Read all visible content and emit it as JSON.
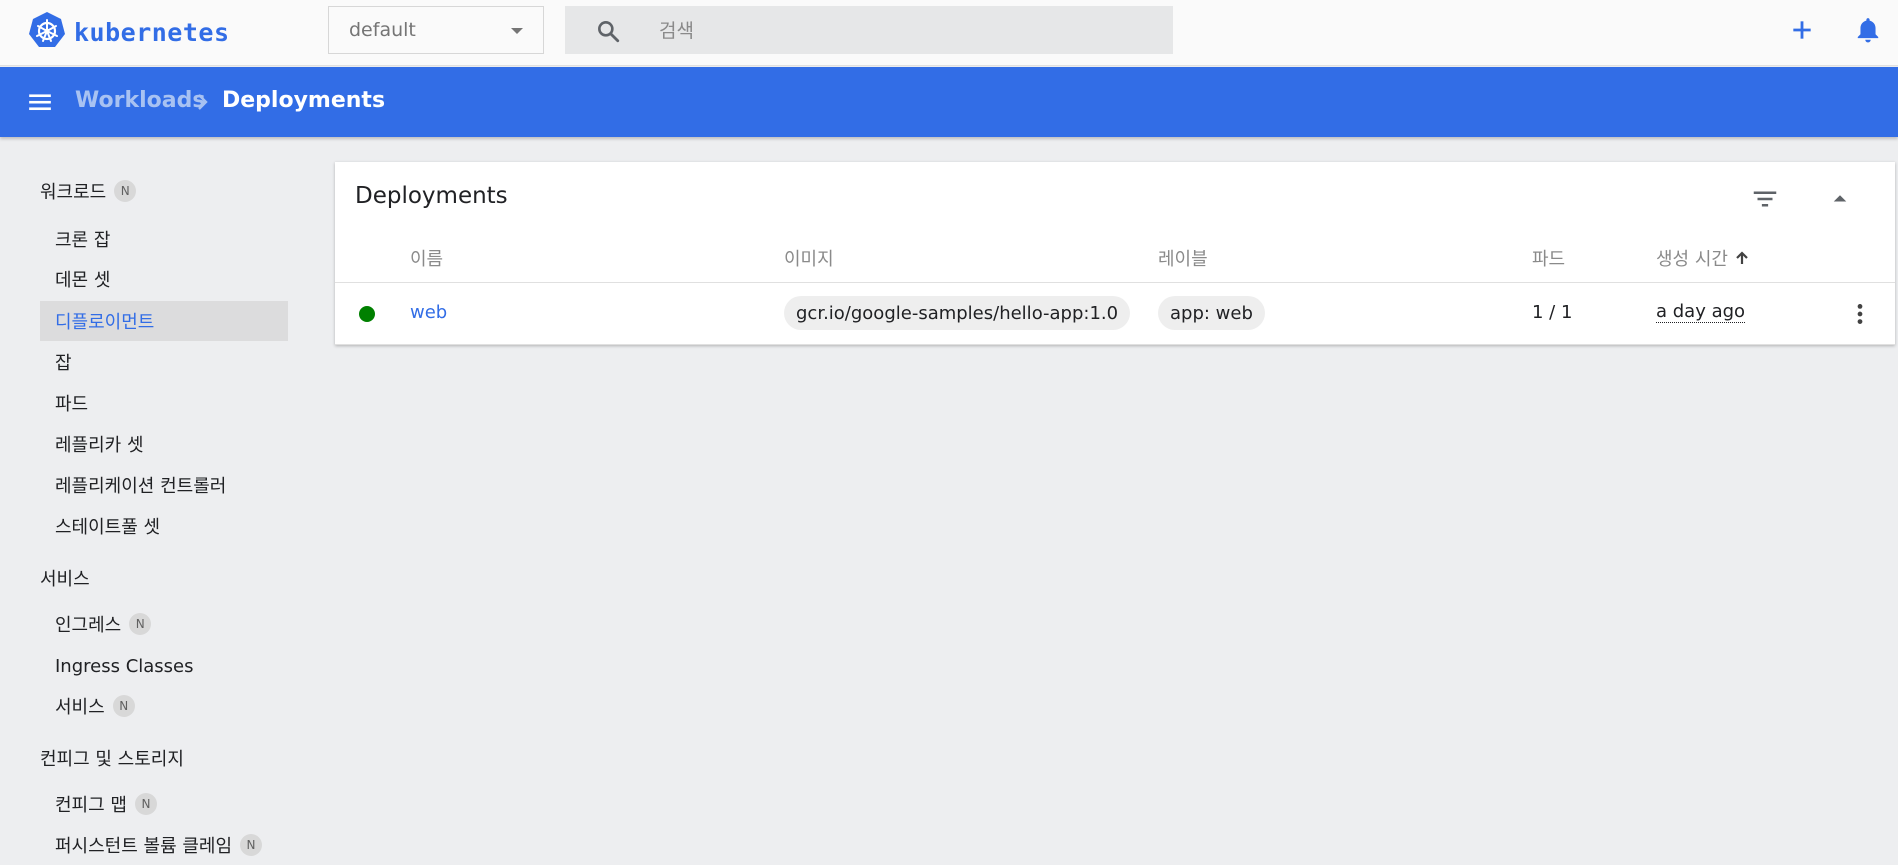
{
  "app": {
    "logo_text": "kubernetes"
  },
  "colors": {
    "brand": "#326de6",
    "status_ok": "#008000"
  },
  "namespace_select": {
    "value": "default"
  },
  "search": {
    "placeholder": "검색",
    "icon": "search-icon"
  },
  "top_actions": {
    "create_icon": "plus-icon",
    "notifications_icon": "bell-icon"
  },
  "breadcrumb": {
    "parent": "Workloads",
    "current": "Deployments"
  },
  "sidebar": {
    "sections": [
      {
        "title": "워크로드",
        "badge": "N",
        "items": [
          {
            "label": "크론 잡"
          },
          {
            "label": "데몬 셋"
          },
          {
            "label": "디플로이먼트",
            "active": true
          },
          {
            "label": "잡"
          },
          {
            "label": "파드"
          },
          {
            "label": "레플리카 셋"
          },
          {
            "label": "레플리케이션 컨트롤러"
          },
          {
            "label": "스테이트풀 셋"
          }
        ]
      },
      {
        "title": "서비스",
        "items": [
          {
            "label": "인그레스",
            "badge": "N"
          },
          {
            "label": "Ingress Classes"
          },
          {
            "label": "서비스",
            "badge": "N"
          }
        ]
      },
      {
        "title": "컨피그 및 스토리지",
        "items": [
          {
            "label": "컨피그 맵",
            "badge": "N"
          },
          {
            "label": "퍼시스턴트 볼륨 클레임",
            "badge": "N"
          }
        ]
      }
    ]
  },
  "card": {
    "title": "Deployments",
    "columns": [
      "이름",
      "이미지",
      "레이블",
      "파드",
      "생성 시간"
    ],
    "sort_icon": "arrow-up-icon",
    "rows": [
      {
        "status": "running",
        "name": "web",
        "image": "gcr.io/google-samples/hello-app:1.0",
        "label": "app: web",
        "pods": "1 / 1",
        "created": "a day ago"
      }
    ]
  }
}
